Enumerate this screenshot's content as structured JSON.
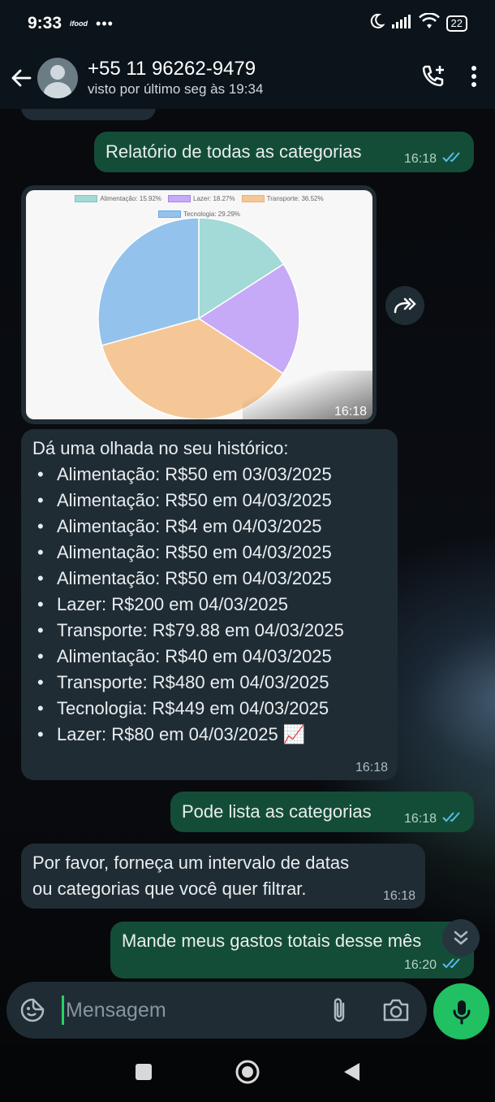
{
  "status_bar": {
    "time": "9:33",
    "app_label": "ifood",
    "dots": "•••",
    "battery": "22"
  },
  "header": {
    "contact_name": "+55 11 96262-9479",
    "last_seen": "visto por último seg às 19:34"
  },
  "messages": {
    "m1": {
      "text": "Relatório de todas as categorias",
      "time": "16:18"
    },
    "m2": {
      "time": "16:18"
    },
    "m3": {
      "intro": "Dá uma olhada no seu histórico:",
      "items": [
        "Alimentação: R$50 em 03/03/2025",
        "Alimentação: R$50 em 04/03/2025",
        "Alimentação: R$4 em 04/03/2025",
        "Alimentação: R$50 em 04/03/2025",
        "Alimentação: R$50 em 04/03/2025",
        "Lazer: R$200 em 04/03/2025",
        "Transporte: R$79.88 em 04/03/2025",
        "Alimentação: R$40 em 04/03/2025",
        "Transporte: R$480 em 04/03/2025",
        "Tecnologia: R$449 em 04/03/2025",
        "Lazer: R$80 em 04/03/2025 📈"
      ],
      "time": "16:18"
    },
    "m4": {
      "text": "Pode lista as categorias",
      "time": "16:18"
    },
    "m5": {
      "text": "Por favor, forneça um intervalo de datas ou categorias que você quer filtrar.",
      "time": "16:18"
    },
    "m6": {
      "text": "Mande meus gastos totais desse mês",
      "time": "16:20"
    }
  },
  "chart_data": {
    "type": "pie",
    "legend": [
      {
        "label": "Alimentação: 15.92%",
        "color": "#a3d9d6",
        "border": "#7fc6c2"
      },
      {
        "label": "Lazer: 18.27%",
        "color": "#c6aaf7",
        "border": "#a983f0"
      },
      {
        "label": "Transporte: 36.52%",
        "color": "#f5c796",
        "border": "#eeb070"
      },
      {
        "label": "Tecnologia: 29.29%",
        "color": "#93c3ec",
        "border": "#6aa9e0"
      }
    ],
    "series": [
      {
        "name": "Alimentação",
        "value": 15.92,
        "color": "#a3d9d6"
      },
      {
        "name": "Lazer",
        "value": 18.27,
        "color": "#c6aaf7"
      },
      {
        "name": "Transporte",
        "value": 36.52,
        "color": "#f5c796"
      },
      {
        "name": "Tecnologia",
        "value": 29.29,
        "color": "#93c3ec"
      }
    ],
    "legend_position": "top",
    "start_angle": "top, clockwise"
  },
  "composer": {
    "placeholder": "Mensagem"
  },
  "colors": {
    "outgoing_bubble": "#144d37",
    "incoming_bubble": "#1f2c34",
    "read_ticks": "#53bdeb",
    "mic_button": "#21c063"
  },
  "icons": [
    "back-arrow-icon",
    "avatar-icon",
    "add-call-icon",
    "more-vert-icon",
    "forward-icon",
    "double-chevron-down-icon",
    "sticker-icon",
    "attach-icon",
    "camera-icon",
    "mic-icon",
    "nav-recents-icon",
    "nav-home-icon",
    "nav-back-icon"
  ]
}
